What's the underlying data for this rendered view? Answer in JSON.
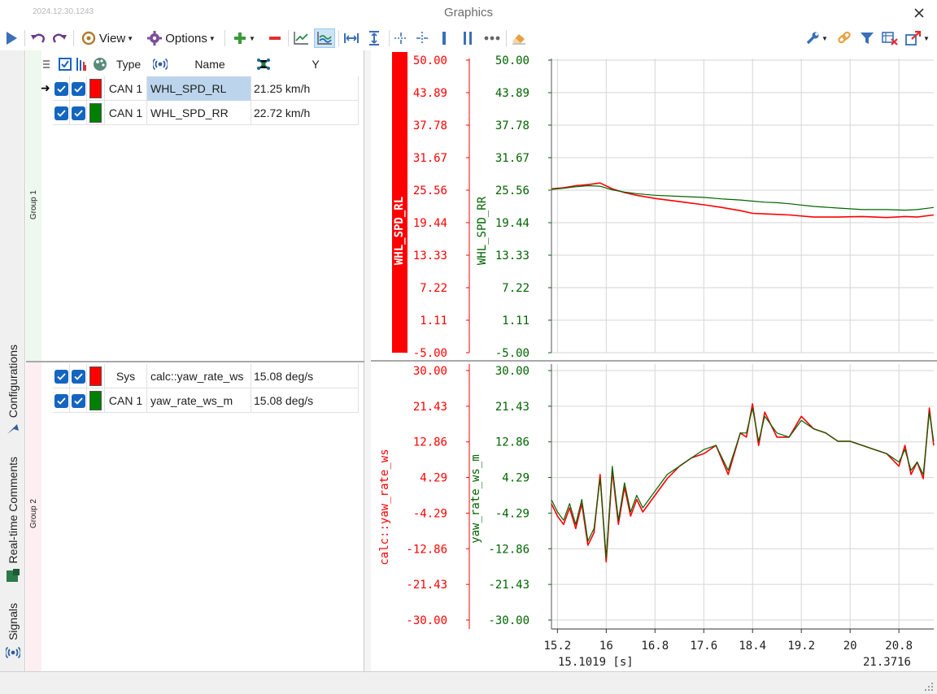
{
  "app": {
    "build": "2024.12.30.1243",
    "title": "Graphics"
  },
  "toolbar": {
    "view_label": "View",
    "options_label": "Options"
  },
  "side_tabs": [
    "Configurations",
    "Real-time Comments",
    "Signals"
  ],
  "columns": {
    "type": "Type",
    "name": "Name",
    "y": "Y"
  },
  "groups": [
    {
      "label": "Group 1",
      "rows": [
        {
          "color": "#ff0000",
          "type": "CAN 1",
          "name": "WHL_SPD_RL",
          "y": "21.25 km/h",
          "selected": true
        },
        {
          "color": "#008000",
          "type": "CAN 1",
          "name": "WHL_SPD_RR",
          "y": "22.72 km/h",
          "selected": false
        }
      ]
    },
    {
      "label": "Group 2",
      "rows": [
        {
          "color": "#ff0000",
          "type": "Sys",
          "name": "calc::yaw_rate_ws",
          "y": "15.08 deg/s",
          "selected": false
        },
        {
          "color": "#008000",
          "type": "CAN 1",
          "name": "yaw_rate_ws_m",
          "y": "15.08 deg/s",
          "selected": false
        }
      ]
    }
  ],
  "colors": {
    "red": "#ff0000",
    "green": "#006400",
    "grid": "#d0d0d0",
    "accent": "#1565c0"
  },
  "chart_data": [
    {
      "type": "line",
      "x_label_start": "15.1019 [s]",
      "x_label_end": "21.3716",
      "xlim": [
        15.1019,
        21.3716
      ],
      "x_ticks": [
        "15.2",
        "16",
        "16.8",
        "17.6",
        "18.4",
        "19.2",
        "20",
        "20.8"
      ],
      "axes": [
        {
          "name": "WHL_SPD_RL",
          "color": "#ff0000",
          "ticks": [
            "50.00",
            "43.89",
            "37.78",
            "31.67",
            "25.56",
            "19.44",
            "13.33",
            "7.22",
            "1.11",
            "-5.00"
          ],
          "ylim": [
            -5,
            50
          ]
        },
        {
          "name": "WHL_SPD_RR",
          "color": "#006400",
          "ticks": [
            "50.00",
            "43.89",
            "37.78",
            "31.67",
            "25.56",
            "19.44",
            "13.33",
            "7.22",
            "1.11",
            "-5.00"
          ],
          "ylim": [
            -5,
            50
          ]
        }
      ],
      "series": [
        {
          "name": "WHL_SPD_RL",
          "color": "#ff0000",
          "x": [
            15.1,
            15.3,
            15.5,
            15.7,
            15.9,
            16.1,
            16.3,
            16.5,
            16.8,
            17.2,
            17.6,
            17.9,
            18.2,
            18.4,
            18.6,
            18.8,
            19.0,
            19.4,
            19.8,
            20.2,
            20.6,
            20.9,
            21.1,
            21.37
          ],
          "y": [
            25.8,
            26.0,
            26.4,
            26.6,
            26.9,
            25.8,
            25.1,
            24.6,
            24.0,
            23.4,
            22.8,
            22.3,
            21.7,
            21.2,
            21.1,
            21.0,
            20.9,
            20.5,
            20.5,
            20.6,
            20.4,
            20.6,
            20.5,
            20.9
          ]
        },
        {
          "name": "WHL_SPD_RR",
          "color": "#006400",
          "x": [
            15.1,
            15.3,
            15.5,
            15.7,
            15.9,
            16.1,
            16.3,
            16.5,
            16.8,
            17.2,
            17.6,
            17.9,
            18.2,
            18.4,
            18.6,
            18.8,
            19.0,
            19.4,
            19.8,
            20.2,
            20.6,
            20.9,
            21.1,
            21.37
          ],
          "y": [
            25.7,
            25.9,
            26.2,
            26.4,
            26.3,
            25.6,
            25.2,
            24.9,
            24.6,
            24.4,
            24.2,
            23.9,
            23.7,
            23.5,
            23.3,
            23.2,
            23.0,
            22.5,
            22.2,
            21.9,
            21.9,
            21.8,
            21.9,
            22.3
          ]
        }
      ]
    },
    {
      "type": "line",
      "xlim": [
        15.1019,
        21.3716
      ],
      "axes": [
        {
          "name": "calc::yaw_rate_ws",
          "color": "#ff0000",
          "ticks": [
            "30.00",
            "21.43",
            "12.86",
            "4.29",
            "-4.29",
            "-12.86",
            "-21.43",
            "-30.00"
          ],
          "ylim": [
            -30,
            30
          ]
        },
        {
          "name": "yaw_rate_ws_m",
          "color": "#006400",
          "ticks": [
            "30.00",
            "21.43",
            "12.86",
            "4.29",
            "-4.29",
            "-12.86",
            "-21.43",
            "-30.00"
          ],
          "ylim": [
            -30,
            30
          ]
        }
      ],
      "series": [
        {
          "name": "calc::yaw_rate_ws",
          "color": "#ff0000",
          "x": [
            15.1,
            15.2,
            15.3,
            15.4,
            15.5,
            15.6,
            15.7,
            15.8,
            15.9,
            16.0,
            16.1,
            16.2,
            16.3,
            16.4,
            16.5,
            16.6,
            16.8,
            17.0,
            17.2,
            17.4,
            17.6,
            17.8,
            18.0,
            18.2,
            18.3,
            18.4,
            18.5,
            18.6,
            18.8,
            19.0,
            19.2,
            19.4,
            19.6,
            19.8,
            20.0,
            20.2,
            20.4,
            20.6,
            20.8,
            20.9,
            21.0,
            21.1,
            21.2,
            21.3,
            21.37
          ],
          "y": [
            -2,
            -5,
            -7,
            -3,
            -8,
            -2,
            -12,
            -9,
            5,
            -16,
            6,
            -7,
            2,
            -5,
            -1,
            -4,
            0,
            4,
            7,
            9,
            10,
            12,
            5,
            15,
            14,
            22,
            12,
            20,
            14,
            14,
            19,
            16,
            15,
            13,
            13,
            12,
            11,
            10,
            7,
            12,
            5,
            8,
            4,
            21,
            12
          ]
        },
        {
          "name": "yaw_rate_ws_m",
          "color": "#006400",
          "x": [
            15.1,
            15.2,
            15.3,
            15.4,
            15.5,
            15.6,
            15.7,
            15.8,
            15.9,
            16.0,
            16.1,
            16.2,
            16.3,
            16.4,
            16.5,
            16.6,
            16.8,
            17.0,
            17.2,
            17.4,
            17.6,
            17.8,
            18.0,
            18.2,
            18.3,
            18.4,
            18.5,
            18.6,
            18.8,
            19.0,
            19.2,
            19.4,
            19.6,
            19.8,
            20.0,
            20.2,
            20.4,
            20.6,
            20.8,
            20.9,
            21.0,
            21.1,
            21.2,
            21.3,
            21.37
          ],
          "y": [
            -1,
            -4,
            -6,
            -2,
            -7,
            -1,
            -11,
            -8,
            4,
            -15,
            7,
            -6,
            3,
            -4,
            0,
            -3,
            1,
            5,
            7,
            9,
            11,
            12,
            6,
            15,
            15,
            21,
            13,
            19,
            15,
            14,
            18,
            16,
            15,
            13,
            13,
            12,
            11,
            10,
            8,
            11,
            6,
            8,
            5,
            20,
            13
          ]
        }
      ]
    }
  ]
}
